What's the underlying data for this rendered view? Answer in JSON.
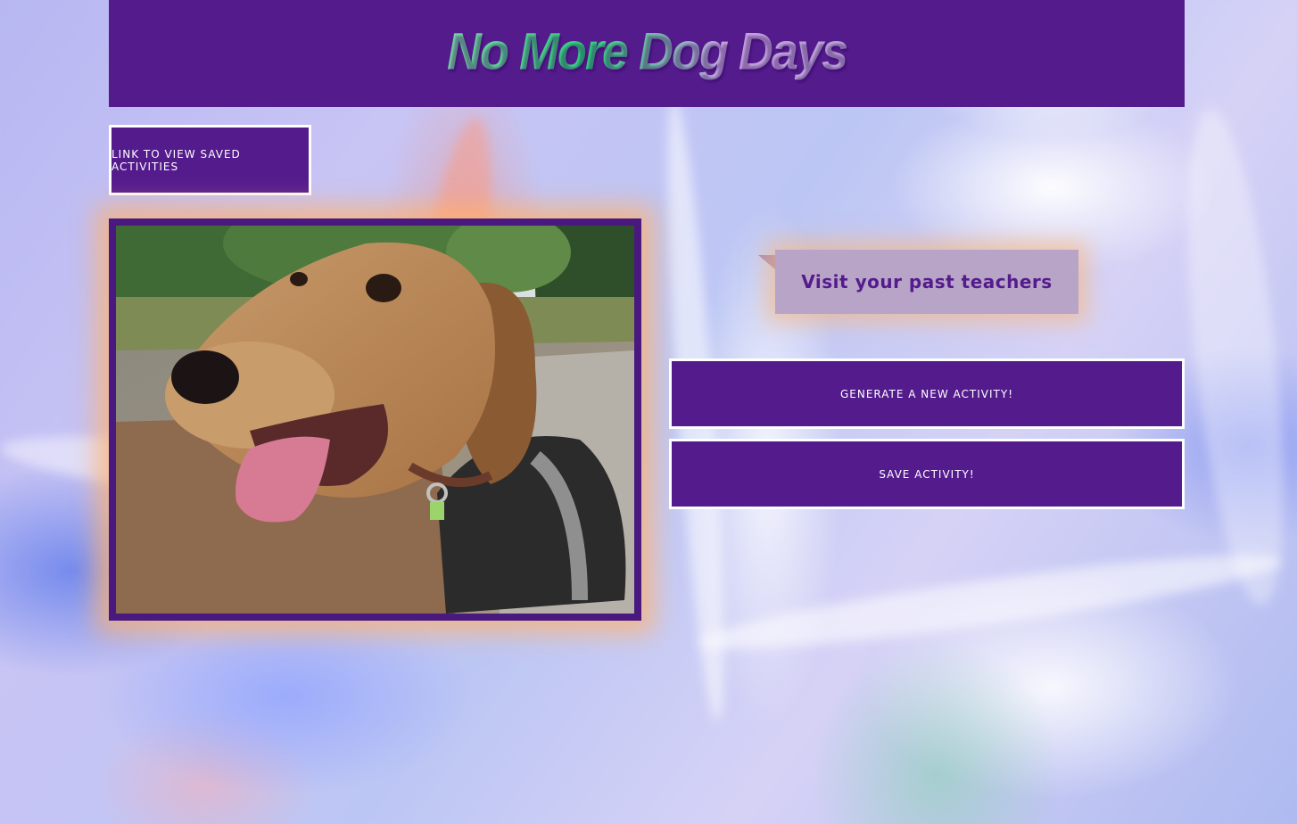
{
  "header": {
    "title": "No More Dog Days"
  },
  "nav": {
    "saved_link_label": "Link to view saved activities"
  },
  "photo": {
    "subject": "dog-photo"
  },
  "activity": {
    "suggestion": "Visit your past teachers"
  },
  "actions": {
    "generate_label": "Generate a new activity!",
    "save_label": "Save activity!"
  },
  "colors": {
    "brand_purple": "#541b8d",
    "bubble_bg": "#b8a4c6",
    "button_border": "#ffffff"
  }
}
